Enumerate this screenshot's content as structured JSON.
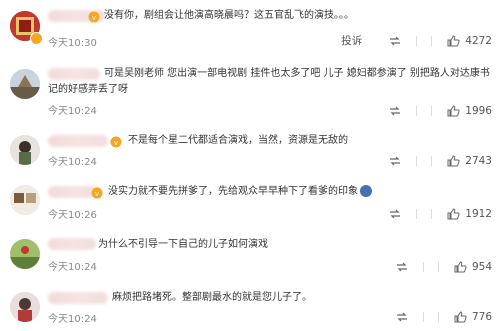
{
  "comments": [
    {
      "text": "没有你，剧组会让他演高晓晨吗？这五官乱飞的演技。。。",
      "time": "今天10:30",
      "likes": "4272",
      "report_label": "投诉",
      "show_report": true
    },
    {
      "text": "可是吴刚老师 您出演一部电视剧 挂件也太多了吧 儿子 媳妇都参演了 别把路人对达康书记的好感弄丢了呀",
      "time": "今天10:24",
      "likes": "1996"
    },
    {
      "text": "不是每个星二代都适合演戏，当然，资源是无敌的",
      "time": "今天10:24",
      "likes": "2743"
    },
    {
      "text": "没实力就不要先拼爹了，先给观众早早种下了看爹的印象",
      "time": "今天10:26",
      "likes": "1912"
    },
    {
      "text": "为什么不引导一下自己的儿子如何演戏",
      "time": "今天10:24",
      "likes": "954"
    },
    {
      "text": "麻烦把路堵死。整部剧最水的就是您儿子了。",
      "time": "今天10:24",
      "likes": "776"
    }
  ],
  "colors": {
    "accent": "#f5a623",
    "time": "#8a8a8a",
    "text": "#333333"
  }
}
